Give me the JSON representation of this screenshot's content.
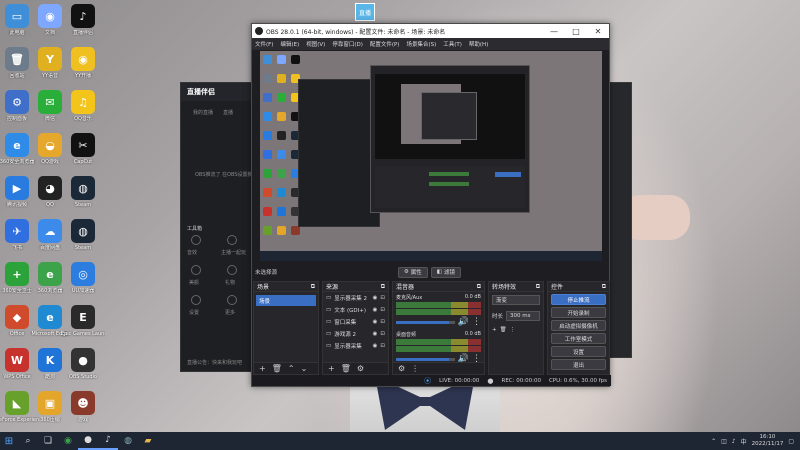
{
  "desktop": {
    "icons": [
      {
        "label": "此电脑",
        "glyph": "▭",
        "color": "#3f8fd8",
        "col": 0,
        "row": 0
      },
      {
        "label": "回收站",
        "glyph": "🗑",
        "color": "#6d7b8a",
        "col": 0,
        "row": 1
      },
      {
        "label": "控制面板",
        "glyph": "⚙",
        "color": "#3f6fc8",
        "col": 0,
        "row": 2
      },
      {
        "label": "360安全浏览器",
        "glyph": "e",
        "color": "#2e8ce8",
        "col": 0,
        "row": 3
      },
      {
        "label": "腾讯视频",
        "glyph": "▶",
        "color": "#2a7be0",
        "col": 0,
        "row": 4
      },
      {
        "label": "飞书",
        "glyph": "✈",
        "color": "#2f6fe0",
        "col": 0,
        "row": 5
      },
      {
        "label": "360安全卫士",
        "glyph": "+",
        "color": "#2ba33a",
        "col": 0,
        "row": 6
      },
      {
        "label": "Office",
        "glyph": "◆",
        "color": "#d04b2c",
        "col": 0,
        "row": 7
      },
      {
        "label": "WPS Office",
        "glyph": "W",
        "color": "#c8322d",
        "col": 0,
        "row": 8
      },
      {
        "label": "GeForce Experience",
        "glyph": "◣",
        "color": "#67a02a",
        "col": 0,
        "row": 9
      },
      {
        "label": "文档",
        "glyph": "◉",
        "color": "#7ea7ff",
        "col": 1,
        "row": 0
      },
      {
        "label": "YY语音",
        "glyph": "Y",
        "color": "#e0b020",
        "col": 1,
        "row": 1
      },
      {
        "label": "微信",
        "glyph": "✉",
        "color": "#2aae3a",
        "col": 1,
        "row": 2
      },
      {
        "label": "QQ游戏",
        "glyph": "◒",
        "color": "#e6a82c",
        "col": 1,
        "row": 3
      },
      {
        "label": "QQ",
        "glyph": "◕",
        "color": "#222222",
        "col": 1,
        "row": 4
      },
      {
        "label": "百度网盘",
        "glyph": "☁",
        "color": "#3c8bea",
        "col": 1,
        "row": 5
      },
      {
        "label": "360浏览器",
        "glyph": "e",
        "color": "#3ca34a",
        "col": 1,
        "row": 6
      },
      {
        "label": "Microsoft Edge",
        "glyph": "e",
        "color": "#1f8ad2",
        "col": 1,
        "row": 7
      },
      {
        "label": "酷狗",
        "glyph": "K",
        "color": "#1f74d8",
        "col": 1,
        "row": 8
      },
      {
        "label": "360压缩",
        "glyph": "▣",
        "color": "#e3a52a",
        "col": 1,
        "row": 9
      },
      {
        "label": "直播伴侣",
        "glyph": "♪",
        "color": "#111111",
        "col": 2,
        "row": 0
      },
      {
        "label": "YY开播",
        "glyph": "◉",
        "color": "#f0c020",
        "col": 2,
        "row": 1
      },
      {
        "label": "QQ音乐",
        "glyph": "♫",
        "color": "#f3c419",
        "col": 2,
        "row": 2
      },
      {
        "label": "CapCut",
        "glyph": "✂",
        "color": "#111111",
        "col": 2,
        "row": 3
      },
      {
        "label": "Steam",
        "glyph": "◍",
        "color": "#1b2838",
        "col": 2,
        "row": 4
      },
      {
        "label": "Steam",
        "glyph": "◍",
        "color": "#1b2838",
        "col": 2,
        "row": 5
      },
      {
        "label": "UU加速器",
        "glyph": "◎",
        "color": "#2b7de0",
        "col": 2,
        "row": 6
      },
      {
        "label": "Epic Games Launcher",
        "glyph": "E",
        "color": "#2a2a2a",
        "col": 2,
        "row": 7
      },
      {
        "label": "OBS Studio",
        "glyph": "●",
        "color": "#333333",
        "col": 2,
        "row": 8
      },
      {
        "label": "游戏",
        "glyph": "☻",
        "color": "#8a3a2a",
        "col": 2,
        "row": 9
      }
    ]
  },
  "companion": {
    "title": "直播伴侣",
    "menu_a": "我的直播",
    "menu_b": "直播",
    "placeholder": "OBS推流了 在OBS设置推流...",
    "tools_label": "工具箱",
    "tool_1": "音效",
    "tool_2": "主播一起玩",
    "tool_3": "美颜",
    "tool_4": "礼物",
    "tool_5": "设置",
    "tool_6": "更多",
    "notice": "直播公告：快来和我玩吧"
  },
  "obs": {
    "window_title": "OBS 28.0.1 (64-bit, windows) - 配置文件: 未命名 - 场景: 未命名",
    "menu": [
      "文件(F)",
      "编辑(E)",
      "视图(V)",
      "停靠窗口(D)",
      "配置文件(P)",
      "场景集合(S)",
      "工具(T)",
      "帮助(H)"
    ],
    "no_source": "未选择源",
    "properties_btn": "属性",
    "filters_btn": "滤镜",
    "scenes": {
      "title": "场景",
      "items": [
        "场景"
      ]
    },
    "sources": {
      "title": "来源",
      "items": [
        "显示器采集 2",
        "文本 (GDI+)",
        "窗口采集",
        "游戏源 2",
        "显示器采集"
      ]
    },
    "mixer": {
      "title": "混音器",
      "tracks": [
        {
          "name": "麦克风/Aux",
          "db": "0.0 dB",
          "level": 0.9
        },
        {
          "name": "桌面音频",
          "db": "0.0 dB",
          "level": 0.9
        }
      ]
    },
    "transitions": {
      "title": "转场特效",
      "mode": "渐变",
      "duration_label": "时长",
      "duration_value": "300 ms"
    },
    "controls": {
      "title": "控件",
      "buttons": [
        "停止推流",
        "开始录制",
        "启动虚拟摄像机",
        "工作室模式",
        "设置",
        "退出"
      ]
    },
    "status": {
      "live": "LIVE: 00:00:00",
      "rec": "REC: 00:00:00",
      "cpu": "CPU: 0.6%, 30.00 fps"
    },
    "thumb_label": "直播"
  },
  "taskbar": {
    "time": "16:10",
    "date": "2022/11/17",
    "tray_lang": "中"
  }
}
